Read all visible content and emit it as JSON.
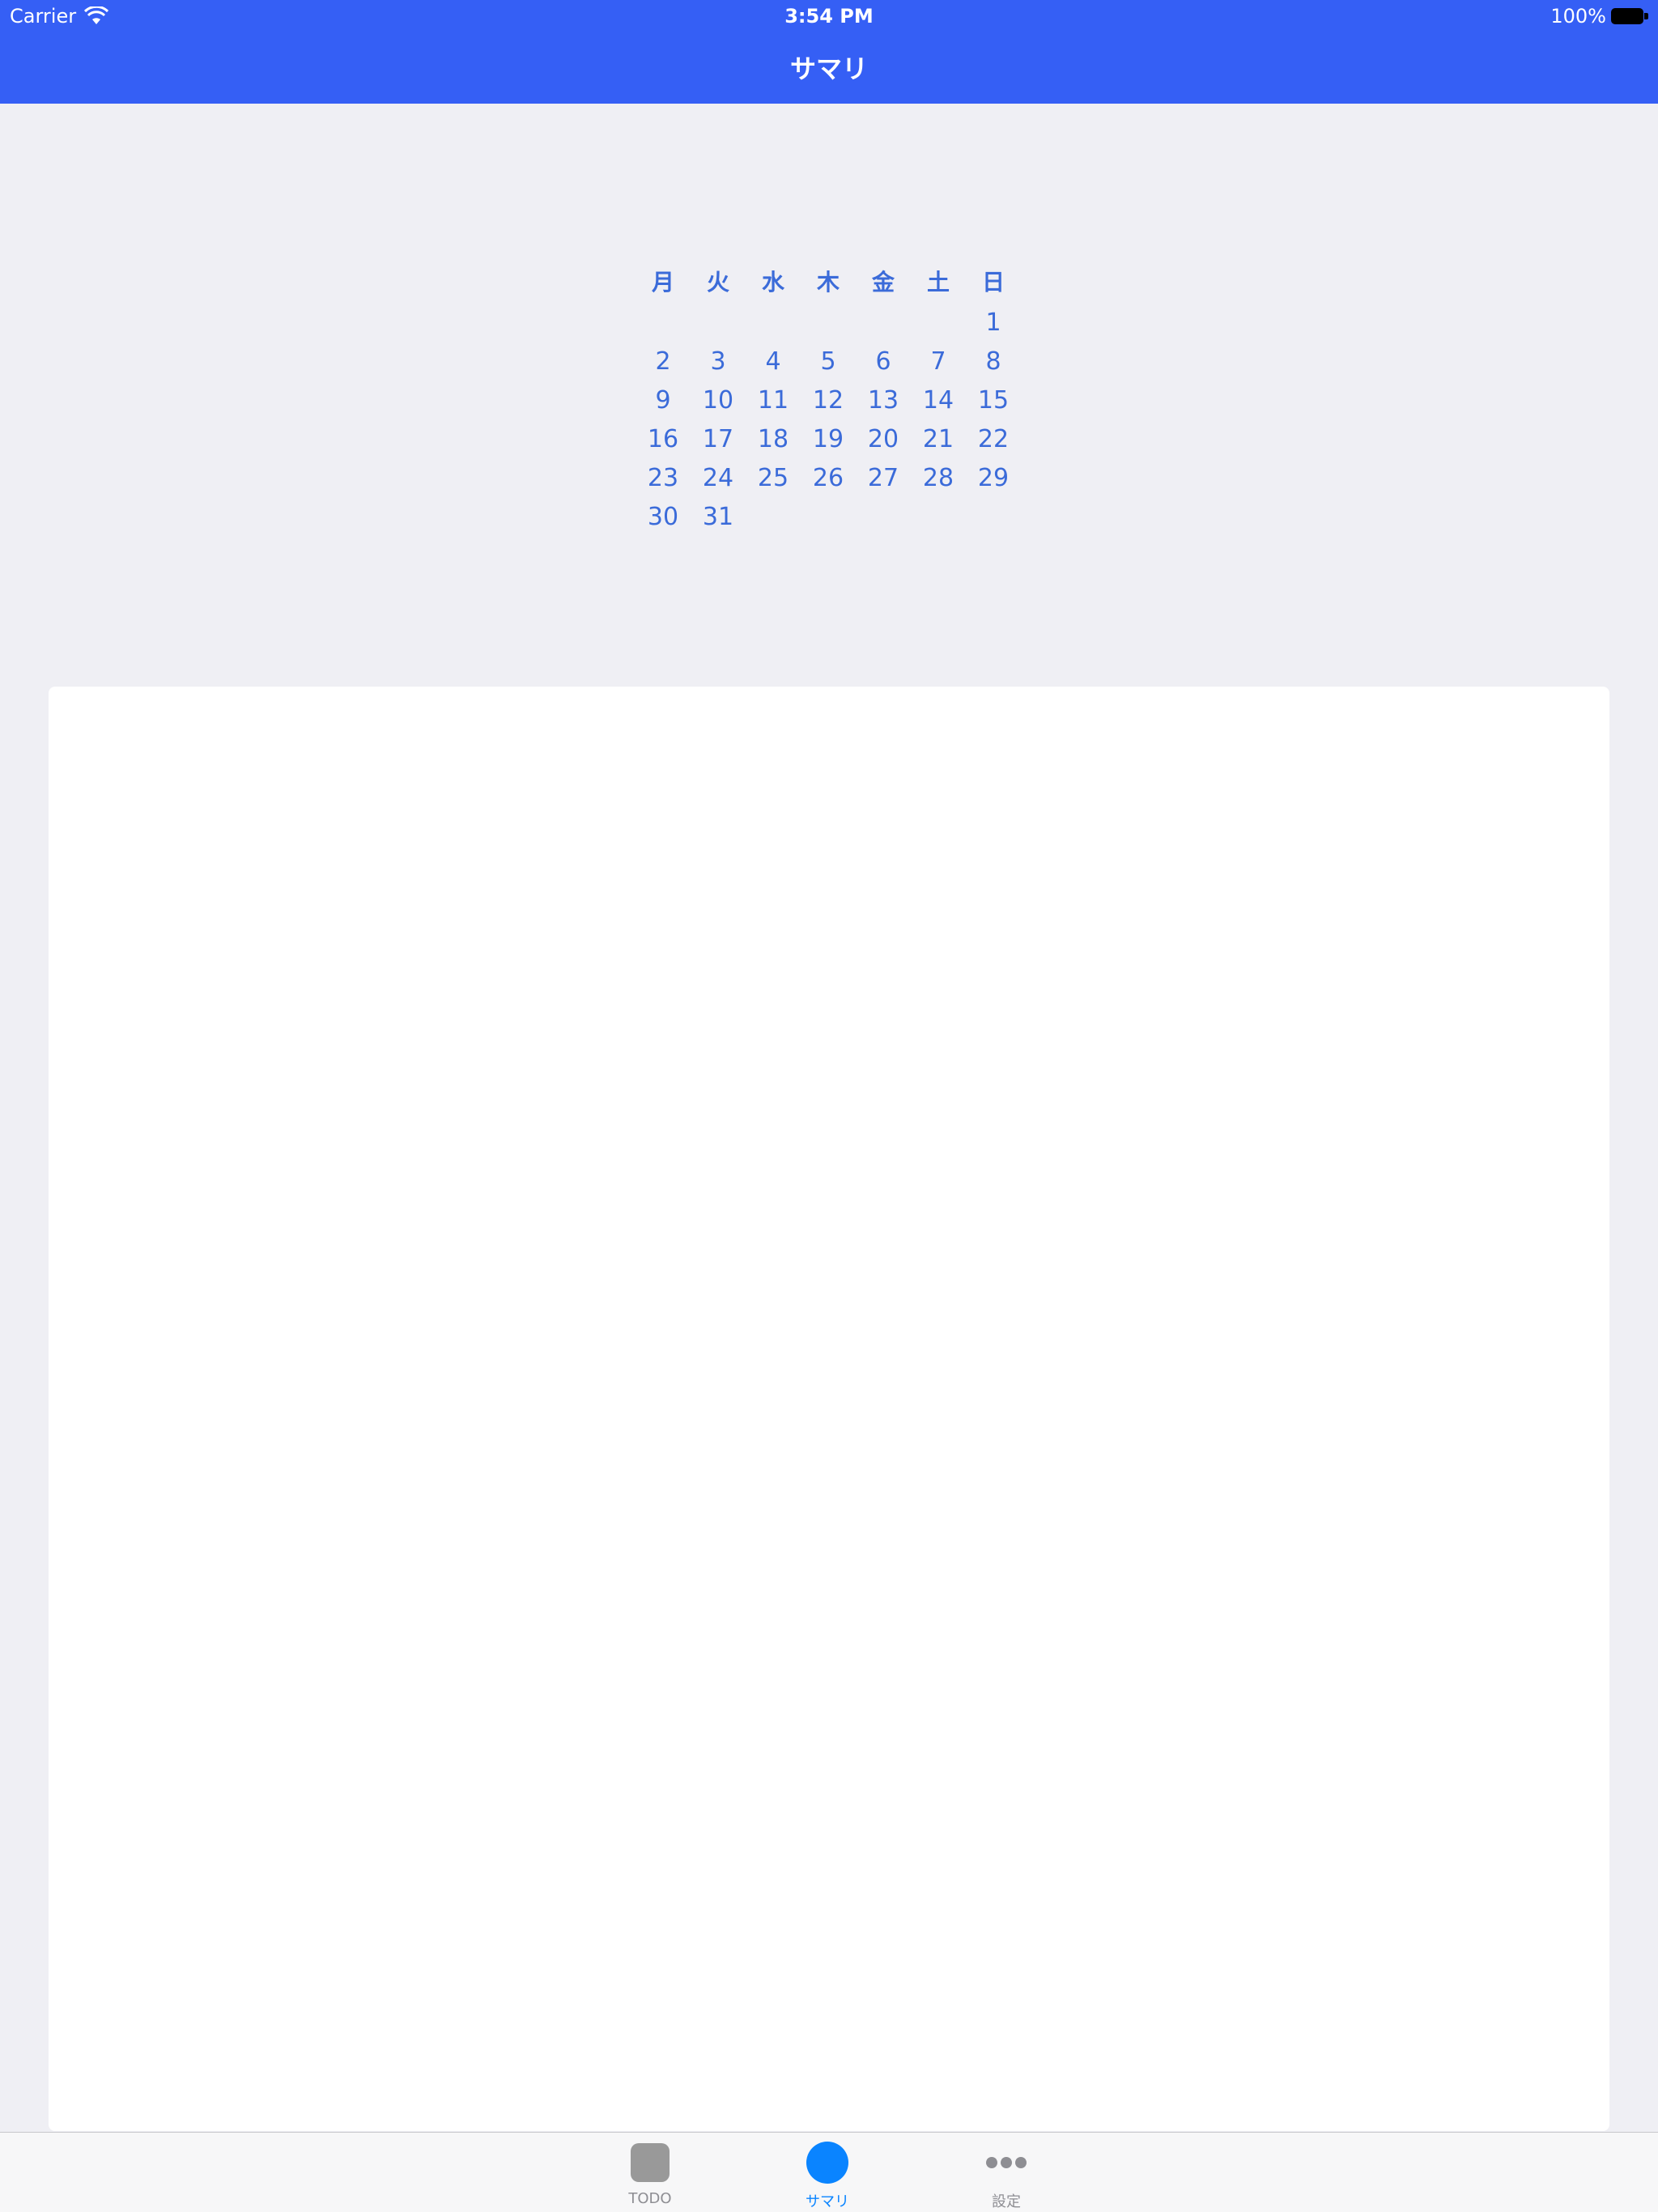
{
  "status_bar": {
    "carrier": "Carrier",
    "time": "3:54 PM",
    "battery": "100%"
  },
  "nav": {
    "title": "サマリ"
  },
  "calendar": {
    "weekdays": [
      "月",
      "火",
      "水",
      "木",
      "金",
      "土",
      "日"
    ],
    "weeks": [
      [
        "",
        "",
        "",
        "",
        "",
        "",
        "1"
      ],
      [
        "2",
        "3",
        "4",
        "5",
        "6",
        "7",
        "8"
      ],
      [
        "9",
        "10",
        "11",
        "12",
        "13",
        "14",
        "15"
      ],
      [
        "16",
        "17",
        "18",
        "19",
        "20",
        "21",
        "22"
      ],
      [
        "23",
        "24",
        "25",
        "26",
        "27",
        "28",
        "29"
      ],
      [
        "30",
        "31",
        "",
        "",
        "",
        "",
        ""
      ]
    ]
  },
  "tabbar": {
    "tabs": [
      {
        "label": "TODO",
        "icon": "square-icon"
      },
      {
        "label": "サマリ",
        "icon": "circle-icon",
        "selected": true
      },
      {
        "label": "設定",
        "icon": "more-dots-icon"
      }
    ]
  },
  "colors": {
    "nav_background": "#355ff5",
    "calendar_text": "#3b6bd9",
    "tab_selected": "#0a84ff",
    "tab_unselected": "#8e8e93"
  }
}
